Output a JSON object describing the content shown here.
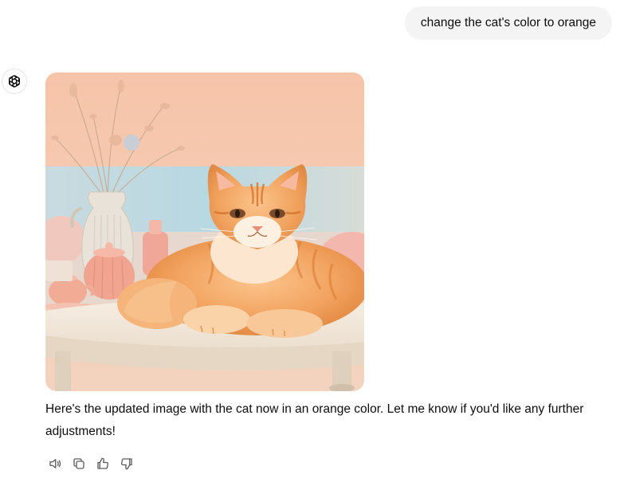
{
  "user_message": {
    "text": "change the cat's color to orange"
  },
  "assistant": {
    "avatar_icon": "openai-logo-icon",
    "image": {
      "subject": "orange cat on table",
      "palette": {
        "wall_top": "#f4c2a8",
        "wall_band": "#b7d7e0",
        "cat_main": "#f0a35e",
        "cat_dark": "#e0843d",
        "cat_light": "#fde6cf",
        "table": "#f3e8da",
        "pottery": "#f0a58f"
      }
    },
    "reply_text": "Here's the updated image with the cat now in an orange color. Let me know if you'd like any further adjustments!",
    "actions": [
      {
        "name": "read-aloud",
        "icon": "speaker-icon"
      },
      {
        "name": "copy",
        "icon": "copy-icon"
      },
      {
        "name": "good-response",
        "icon": "thumbs-up-icon"
      },
      {
        "name": "bad-response",
        "icon": "thumbs-down-icon"
      }
    ]
  }
}
